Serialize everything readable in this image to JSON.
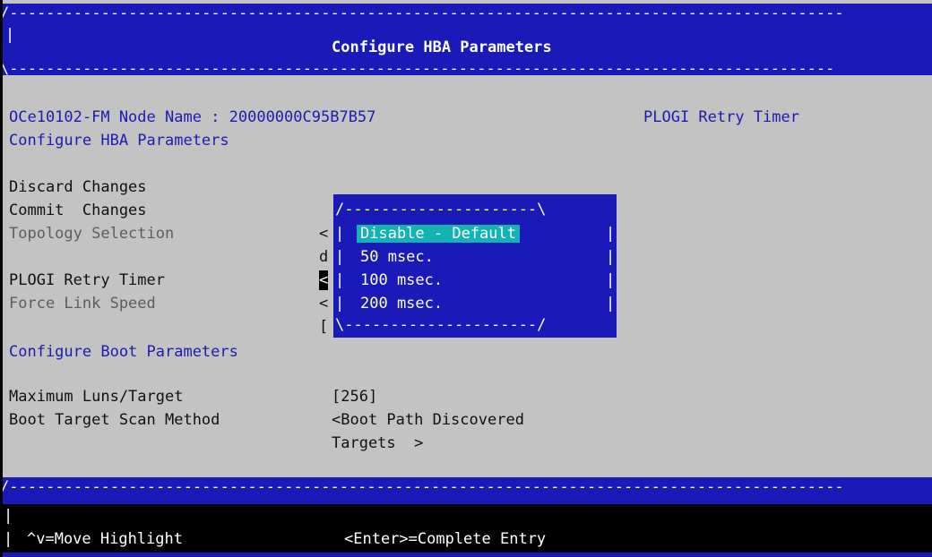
{
  "header": {
    "dash_top": "/-------------------------------------------------------------------------------------------",
    "left_border": "|",
    "title": "Configure HBA Parameters",
    "dash_bottom": "\\------------------------------------------------------------------------------------------"
  },
  "info": {
    "node_line": "OCe10102-FM Node Name : 20000000C95B7B57",
    "section_title": "Configure HBA Parameters",
    "help_title": "PLOGI Retry Timer"
  },
  "menu": {
    "discard": "Discard Changes",
    "commit": "Commit  Changes",
    "topology_label": "Topology Selection",
    "topology_value_frag": "<",
    "hidden_frag_d": "d",
    "plogi_label": "PLOGI Retry Timer",
    "plogi_value_frag": "<",
    "link_label": "Force Link Speed",
    "link_value_frag": "<",
    "hidden_frag_bracket": "[",
    "boot_section": "Configure Boot Parameters",
    "max_luns_label": "Maximum Luns/Target",
    "max_luns_value": "[256]",
    "scan_label": "Boot Target Scan Method",
    "scan_value_line1": "<Boot Path Discovered",
    "scan_value_line2": "Targets  >"
  },
  "popup": {
    "top_border": "/---------------------\\",
    "bottom_border": "\\---------------------/",
    "side": "|",
    "options": [
      "Disable - Default",
      "50 msec.",
      "100 msec.",
      "200 msec."
    ],
    "selected_index": 0
  },
  "footer": {
    "dash_top": "/-------------------------------------------------------------------------------------------",
    "left_border": "|",
    "hint_move": "^v=Move Highlight",
    "hint_enter": "<Enter>=Complete Entry"
  },
  "colors": {
    "panel_bg": "#c3c3c3",
    "frame_blue": "#1a1ab8",
    "highlight": "#14b3b3",
    "label_blue": "#1c1cb0",
    "disabled_grey": "#5d5d5d"
  }
}
